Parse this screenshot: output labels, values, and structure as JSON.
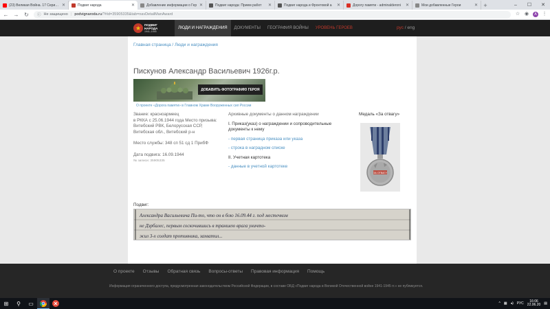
{
  "browser": {
    "tabs": [
      {
        "label": "(23) Великая Война. 17 Серия. В",
        "fav": "#ff0000",
        "active": false
      },
      {
        "label": "Подвиг народа",
        "fav": "#c0392b",
        "active": true
      },
      {
        "label": "Добавление информации о Гер",
        "fav": "#888888",
        "active": false
      },
      {
        "label": "Подвиг народа: Прием работ",
        "fav": "#555555",
        "active": false
      },
      {
        "label": "Подвиг народа и Фронтовой а",
        "fav": "#555555",
        "active": false
      },
      {
        "label": "Дорогу памяти - adminalderoni",
        "fav": "#d93025",
        "active": false
      },
      {
        "label": "Мои добавленные Герои",
        "fav": "#888888",
        "active": false
      }
    ],
    "new_tab": "+",
    "secure_label": "Не защищено",
    "url_host": "podvignaroda.ru",
    "url_rest": "/?#id=35905335&tab=navDetailManAward",
    "avatar_letter": "A"
  },
  "site": {
    "logo_line1": "ПОДВИГ",
    "logo_line2": "НАРОДА",
    "logo_years": "1941–1945",
    "nav": [
      {
        "label": "ЛЮДИ И НАГРАЖДЕНИЯ",
        "state": "active"
      },
      {
        "label": "ДОКУМЕНТЫ",
        "state": "normal"
      },
      {
        "label": "ГЕОГРАФИЯ ВОЙНЫ",
        "state": "normal"
      },
      {
        "label": "УРОВЕНЬ ГЕРОЕВ",
        "state": "red"
      }
    ],
    "lang_cur": "рус",
    "lang_sep": " / ",
    "lang_alt": "eng"
  },
  "page": {
    "breadcrumb": "Главная страница / Люди и награждения",
    "hero_name": "Пискунов Александр Васильевич 1926г.р.",
    "banner_button": "Добавить фотографию Героя",
    "banner_caption": "О проекте «Дорога памяти» в Главном Храме Вооруженных сил России",
    "info": {
      "rank": "Звание: красноармеец",
      "service": "в РККА с 25.06.1944 года Место призыва: Витебский РВК, Белорусская ССР, Витебская обл., Витебский р-н",
      "unit": "Место службы: 348 сп 51 сд 1 ПрибФ",
      "feat_date": "Дата подвига: 16.09.1944",
      "record_no": "№ записи: 35905335"
    },
    "docs": {
      "heading": "Архивные документы о данном награждении",
      "section1": "I. Приказ(указ) о награждении и сопроводительные документы к нему",
      "link1": "- первая страница приказа или указа",
      "link2": "- строка в наградном списке",
      "section2": "II. Учетная картотека",
      "link3": "- данные в учетной картотеке"
    },
    "medal_title": "Медаль «За отвагу»",
    "medal_text": "ЗА ОТВАГУ",
    "feat_label": "Подвиг:",
    "scan_text_1": "Александра Васильевича Пи-то, что он в бою 16.09.44 г. под местечком",
    "scan_text_2": "не Дзрбалес, первым соскочившись в траншею врага уничто-",
    "scan_text_3": "жил 3-х солдат противника, захватил..."
  },
  "footer": {
    "links": [
      "О проекте",
      "Отзывы",
      "Обратная связь",
      "Вопросы-ответы",
      "Правовая информация",
      "Помощь"
    ],
    "note": "Информация ограниченного доступа, предусмотренная законодательством Российской Федерации, в составе ОБД «Подвиг народа в Великой Отечественной войне 1941-1945 гг.» не публикуется."
  },
  "taskbar": {
    "lang": "РУС",
    "time": "16:06",
    "date": "22.06.20"
  }
}
